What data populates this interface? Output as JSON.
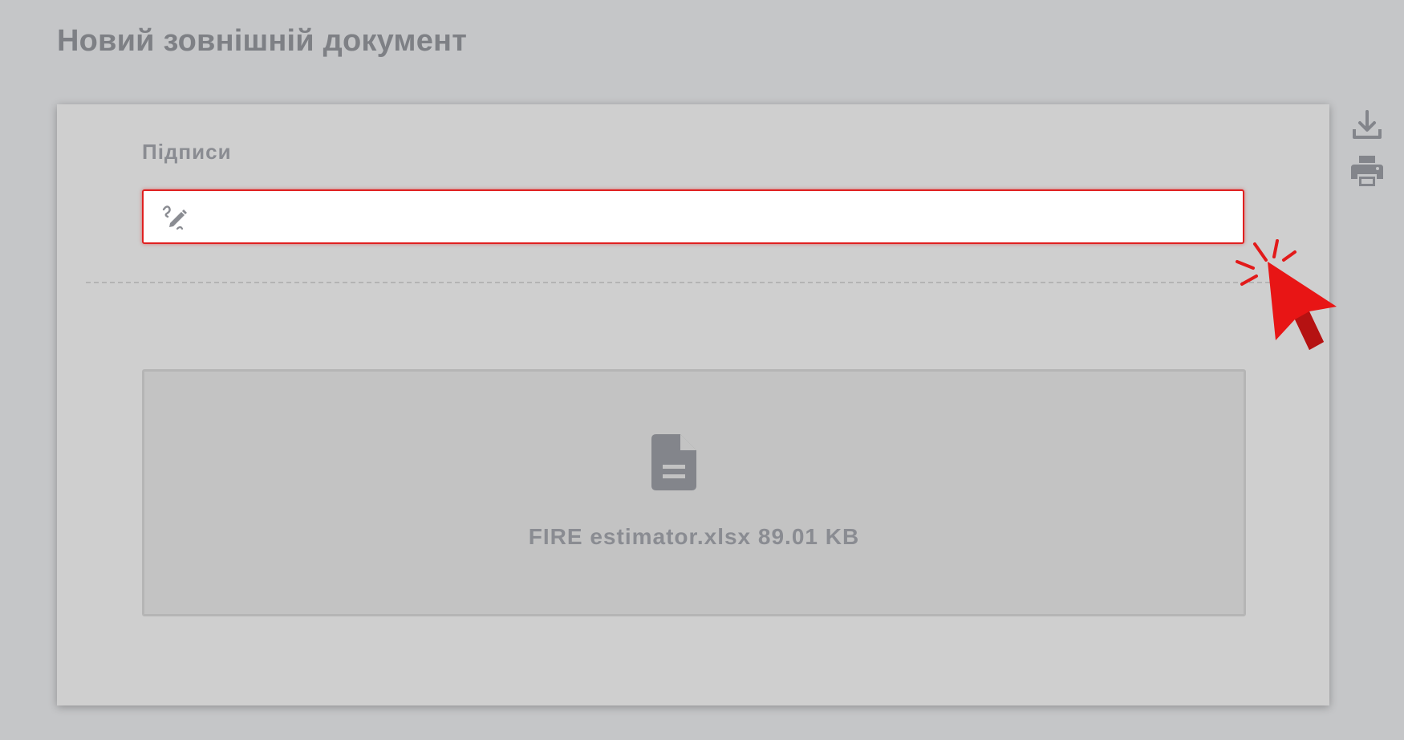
{
  "page": {
    "title": "Новий зовнішній документ"
  },
  "signatures": {
    "label": "Підписи",
    "field_value": "",
    "icon": "signature-icon"
  },
  "attachment": {
    "icon": "file-document-icon",
    "caption": "FIRE estimator.xlsx 89.01 KB"
  },
  "side_actions": [
    {
      "name": "download-icon"
    },
    {
      "name": "print-icon"
    }
  ],
  "colors": {
    "page_bg": "#c5c6c8",
    "card_bg": "#cfcfcf",
    "highlight": "#e02020",
    "text_muted": "#8a8c92",
    "title": "#7e8085"
  }
}
